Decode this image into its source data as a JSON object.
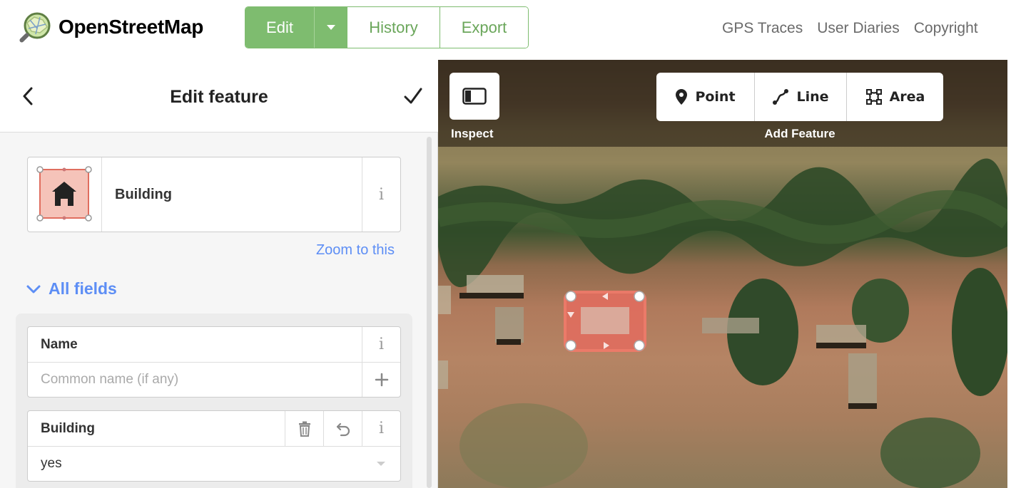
{
  "header": {
    "brand": "OpenStreetMap",
    "buttons": {
      "edit": "Edit",
      "history": "History",
      "export": "Export"
    },
    "links": [
      "GPS Traces",
      "User Diaries",
      "Copyright"
    ]
  },
  "sidebar": {
    "title": "Edit feature",
    "preset": {
      "name": "Building",
      "info": "i"
    },
    "zoom_link": "Zoom to this",
    "all_fields": "All fields",
    "fields": {
      "name": {
        "label": "Name",
        "info": "i",
        "placeholder": "Common name (if any)"
      },
      "building": {
        "label": "Building",
        "info": "i",
        "value": "yes"
      }
    }
  },
  "map": {
    "inspect_label": "Inspect",
    "add_feature_label": "Add Feature",
    "modes": {
      "point": "Point",
      "line": "Line",
      "area": "Area"
    }
  },
  "colors": {
    "osm_green": "#7ebc6f",
    "link_blue": "#5d8ef5",
    "feature_red": "#e06e5f"
  },
  "icons": [
    "osm-logo-icon",
    "caret-down-icon",
    "back-chevron-icon",
    "checkmark-icon",
    "house-icon",
    "trash-icon",
    "undo-icon",
    "plus-icon",
    "chevron-down-icon",
    "sidebar-toggle-icon",
    "point-marker-icon",
    "line-icon",
    "area-icon"
  ]
}
